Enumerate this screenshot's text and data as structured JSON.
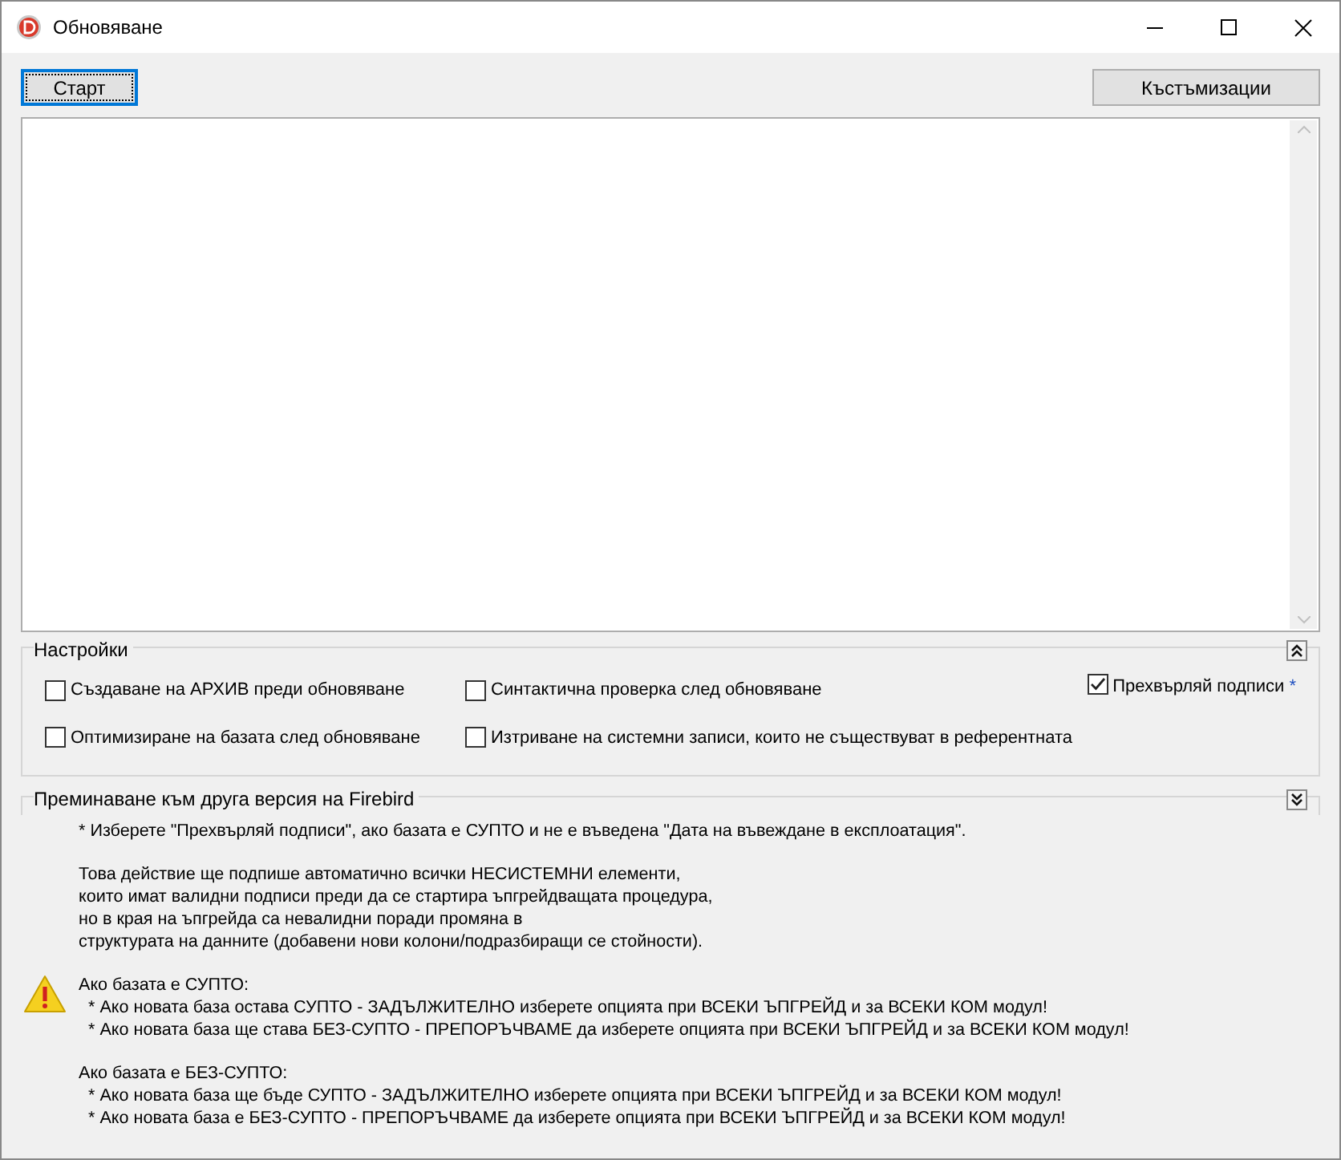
{
  "window": {
    "title": "Обновяване"
  },
  "toolbar": {
    "start_button": "Старт",
    "customize_button": "Къстъмизации"
  },
  "settings": {
    "title": "Настройки",
    "expanded": true,
    "options": [
      {
        "label": "Създаване на АРХИВ преди обновяване",
        "checked": false
      },
      {
        "label": "Синтактична проверка след обновяване",
        "checked": false
      },
      {
        "label": "Оптимизиране на базата след обновяване",
        "checked": false
      },
      {
        "label": "Изтриване на системни записи, които не съществуват в референтната",
        "checked": false
      }
    ],
    "transfer_signatures": {
      "label": "Прехвърляй подписи",
      "mark": "*",
      "checked": true
    }
  },
  "firebird": {
    "title": "Преминаване към друга версия на Firebird",
    "expanded": false
  },
  "notes": [
    {
      "kind": "plain",
      "lines": [
        "* Изберете \"Прехвърляй подписи\", ако базата е СУПТО и не е въведена \"Дата на въвеждане в експлоатация\"."
      ]
    },
    {
      "kind": "plain",
      "lines": [
        "Това действие ще подпише автоматично всички НЕСИСТЕМНИ елементи,",
        "които имат валидни подписи преди да се стартира ъпгрейдващата процедура,",
        "но в края на ъпгрейда са невалидни поради промяна в",
        "структурата на данните (добавени нови колони/подразбиращи се стойности)."
      ]
    },
    {
      "kind": "warning",
      "lines": [
        "Ако базата е СУПТО:",
        "  * Ако новата база остава СУПТО - ЗАДЪЛЖИТЕЛНО изберете опцията при ВСЕКИ ЪПГРЕЙД и за ВСЕКИ КОМ модул!",
        "  * Ако новата база ще става БЕЗ-СУПТО - ПРЕПОРЪЧВАМЕ да изберете опцията при ВСЕКИ ЪПГРЕЙД и за ВСЕКИ КОМ модул!"
      ]
    },
    {
      "kind": "plain",
      "lines": [
        "Ако базата е БЕЗ-СУПТО:",
        "  * Ако новата база ще бъде СУПТО - ЗАДЪЛЖИТЕЛНО изберете опцията при ВСЕКИ ЪПГРЕЙД и за ВСЕКИ КОМ модул!",
        "  * Ако новата база е БЕЗ-СУПТО - ПРЕПОРЪЧВАМЕ да изберете опцията при ВСЕКИ ЪПГРЕЙД и за ВСЕКИ КОМ модул!"
      ]
    }
  ]
}
